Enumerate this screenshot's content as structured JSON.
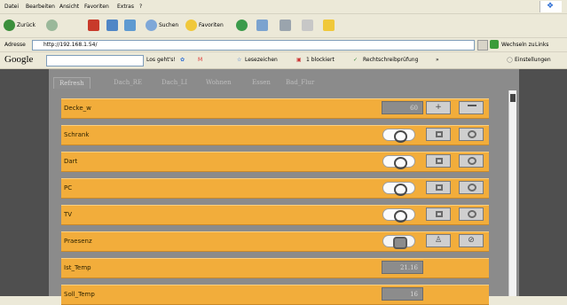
{
  "menu": [
    "Datei",
    "Bearbeiten",
    "Ansicht",
    "Favoriten",
    "Extras",
    "?"
  ],
  "toolbar": {
    "back_label": "Zurück",
    "search_label": "Suchen",
    "favorites_label": "Favoriten"
  },
  "address": {
    "label": "Adresse",
    "url": "http://192.168.1.54/",
    "go_label": "Wechseln zu",
    "links_label": "Links"
  },
  "google": {
    "logo": "Google",
    "search_label": "Los geht's!",
    "bookmarks_label": "Lesezeichen",
    "blocked_label": "1 blockiert",
    "spell_label": "Rechtschreibprüfung",
    "more_label": "»",
    "settings_label": "Einstellungen"
  },
  "tabs": [
    "Refresh",
    "Dach_RE",
    "Dach_LI",
    "Wohnen",
    "Essen",
    "Bad_Flur"
  ],
  "rows": [
    {
      "name": "Decke_w",
      "value": "60"
    },
    {
      "name": "Schrank",
      "value": ""
    },
    {
      "name": "Dart",
      "value": ""
    },
    {
      "name": "PC",
      "value": ""
    },
    {
      "name": "TV",
      "value": ""
    },
    {
      "name": "Praesenz",
      "value": ""
    },
    {
      "name": "Ist_Temp",
      "value": "21.16"
    },
    {
      "name": "Soll_Temp",
      "value": "16"
    }
  ],
  "colors": {
    "row_orange": "#f2ad3b",
    "panel_gray": "#8b8b8b",
    "page_dark": "#4f4f4f"
  }
}
